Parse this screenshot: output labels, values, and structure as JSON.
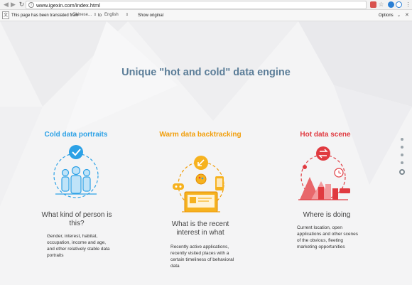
{
  "browser": {
    "url": "www.igexin.com/index.html",
    "back_icon": "arrow-left-icon",
    "forward_icon": "arrow-right-icon",
    "reload_icon": "reload-icon"
  },
  "translate_bar": {
    "message": "This page has been translated from",
    "source_language": "Chinese...",
    "to_label": "to",
    "target_language": "English",
    "show_original_label": "Show original",
    "options_label": "Options"
  },
  "page": {
    "headline": "Unique \"hot and cold\" data engine",
    "columns": [
      {
        "title": "Cold data portraits",
        "question": "What kind of person is this?",
        "description": "Gender, interest, habitat, occupation, income and age, and other relatively stable data portraits",
        "color": "#2ca1e6"
      },
      {
        "title": "Warm data backtracking",
        "question": "What is the recent interest in what",
        "description": "Recently active applications, recently visited places with a certain timeliness of behavioral data",
        "color": "#f19e0a"
      },
      {
        "title": "Hot data scene",
        "question": "Where is doing",
        "description": "Current location, open applications and other scenes of the obvious, fleeting marketing opportunities",
        "color": "#e03a40"
      }
    ]
  },
  "pager": {
    "count": 5,
    "active_index": 4
  }
}
